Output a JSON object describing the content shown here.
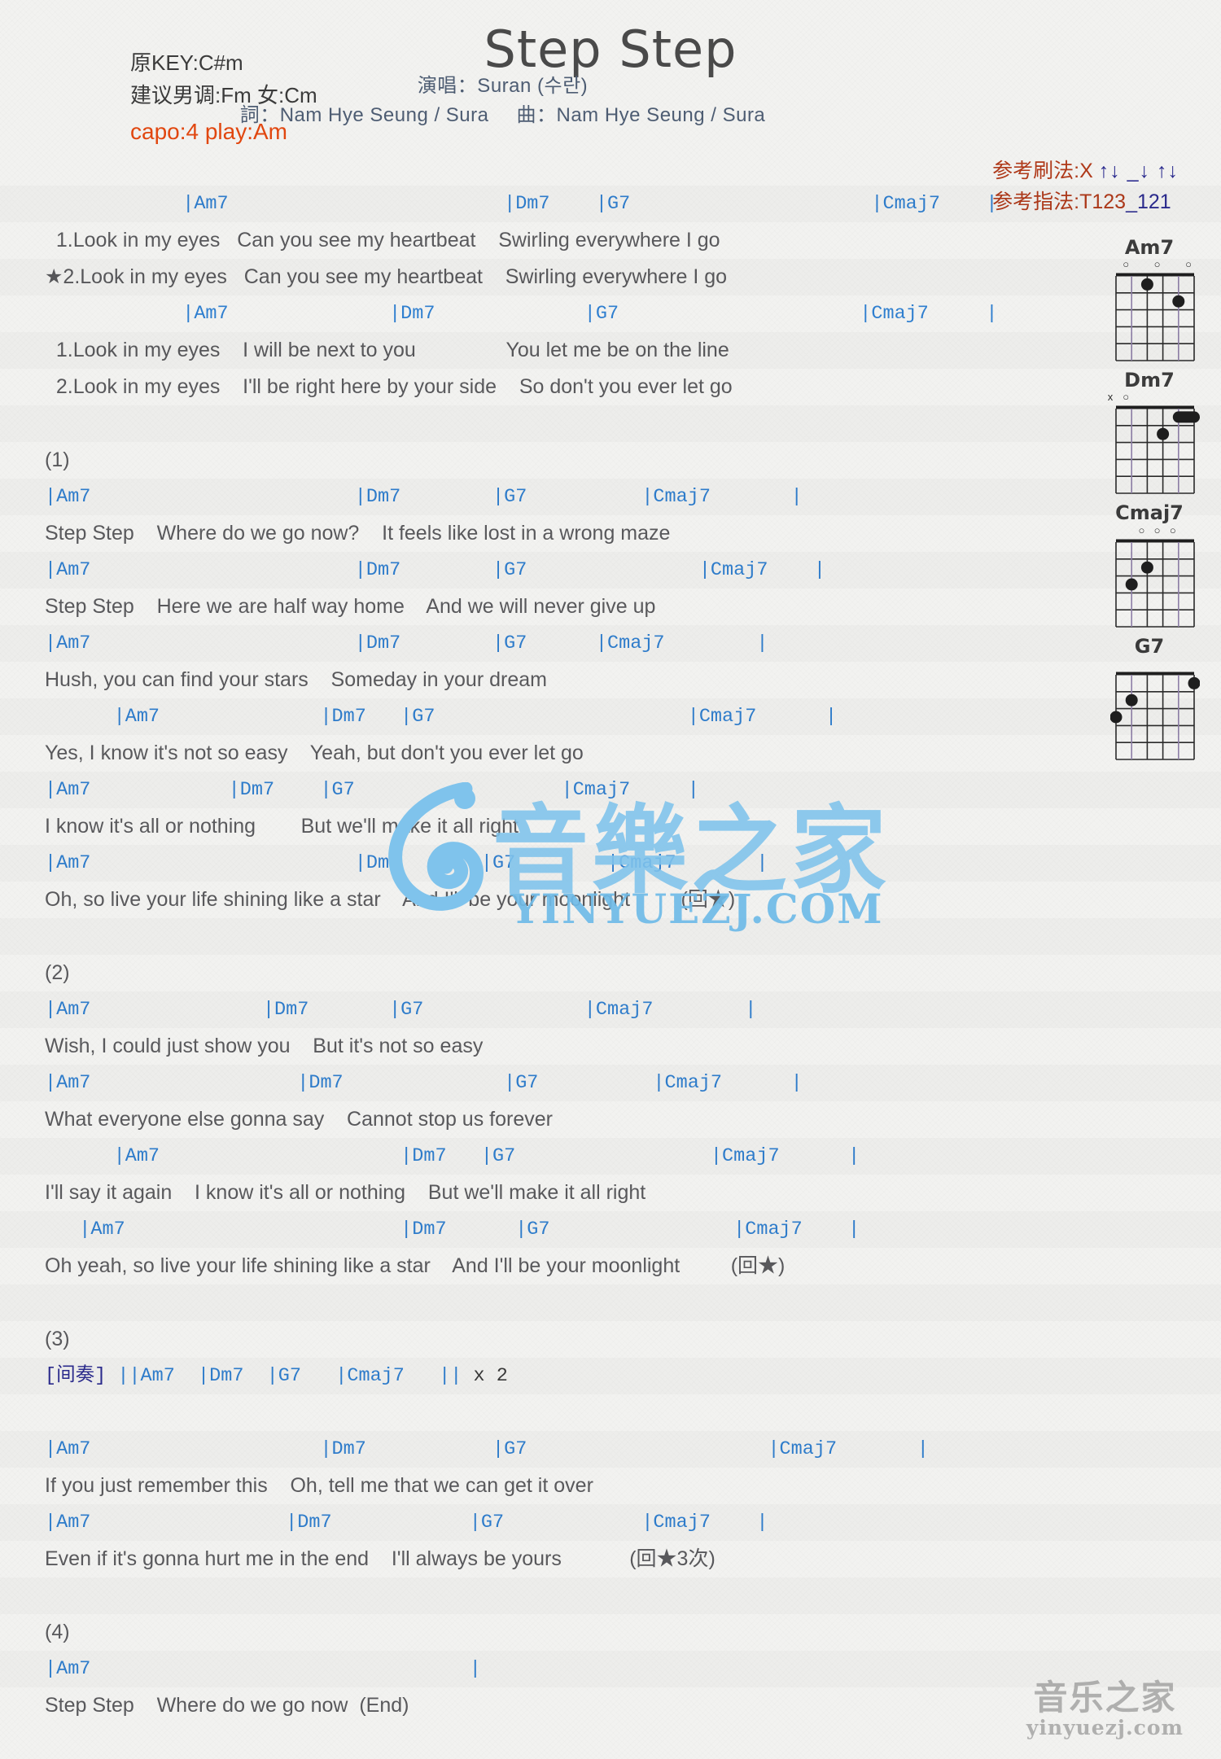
{
  "header": {
    "title": "Step Step",
    "key_original": "原KEY:C#m",
    "key_suggest": "建议男调:Fm 女:Cm",
    "capo": "capo:4 play:Am",
    "singer": "演唱：Suran (수란)",
    "lyricist": "詞：Nam Hye Seung / Sura",
    "composer": "曲：Nam Hye Seung / Sura",
    "strum_label": "参考刷法:X",
    "strum_pattern": "↑↓ _↓ ↑↓",
    "fingerstyle_label": "参考指法:",
    "fingerstyle_pattern_a": "T123",
    "fingerstyle_pattern_b": "_121"
  },
  "chord_diagrams": [
    {
      "name": "Am7",
      "top_markers": [
        {
          "sym": "o",
          "string": 1
        },
        {
          "sym": "o",
          "string": 3
        },
        {
          "sym": "o",
          "string": 5
        }
      ],
      "dots": [
        {
          "string": 2,
          "fret": 1
        },
        {
          "string": 4,
          "fret": 2
        }
      ]
    },
    {
      "name": "Dm7",
      "top_markers": [
        {
          "sym": "x",
          "string": 0
        },
        {
          "sym": "o",
          "string": 1
        }
      ],
      "dots": [
        {
          "string": 3,
          "fret": 2
        }
      ],
      "barre": {
        "fret": 1,
        "from": 4,
        "to": 5
      }
    },
    {
      "name": "Cmaj7",
      "top_markers": [
        {
          "sym": "o",
          "string": 2
        },
        {
          "sym": "o",
          "string": 3
        },
        {
          "sym": "o",
          "string": 4
        }
      ],
      "dots": [
        {
          "string": 2,
          "fret": 2
        },
        {
          "string": 1,
          "fret": 3
        }
      ]
    },
    {
      "name": "G7",
      "top_markers": [],
      "dots": [
        {
          "string": 5,
          "fret": 1
        },
        {
          "string": 1,
          "fret": 2
        },
        {
          "string": 0,
          "fret": 3
        }
      ]
    }
  ],
  "sheet": [
    {
      "type": "chord",
      "text": "            |Am7                        |Dm7    |G7                     |Cmaj7    |"
    },
    {
      "type": "lyric",
      "text": "  1.Look in my eyes   Can you see my heartbeat    Swirling everywhere I go"
    },
    {
      "type": "lyric",
      "text": "★2.Look in my eyes   Can you see my heartbeat    Swirling everywhere I go"
    },
    {
      "type": "chord",
      "text": "            |Am7              |Dm7             |G7                     |Cmaj7     |"
    },
    {
      "type": "lyric",
      "text": "  1.Look in my eyes    I will be next to you                You let me be on the line"
    },
    {
      "type": "lyric",
      "text": "  2.Look in my eyes    I'll be right here by your side    So don't you ever let go"
    },
    {
      "type": "spacer"
    },
    {
      "type": "label",
      "text": "(1)"
    },
    {
      "type": "chord",
      "text": "|Am7                       |Dm7        |G7          |Cmaj7       |"
    },
    {
      "type": "lyric",
      "text": "Step Step    Where do we go now?    It feels like lost in a wrong maze"
    },
    {
      "type": "chord",
      "text": "|Am7                       |Dm7        |G7               |Cmaj7    |"
    },
    {
      "type": "lyric",
      "text": "Step Step    Here we are half way home    And we will never give up"
    },
    {
      "type": "chord",
      "text": "|Am7                       |Dm7        |G7      |Cmaj7        |"
    },
    {
      "type": "lyric",
      "text": "Hush, you can find your stars    Someday in your dream"
    },
    {
      "type": "chord",
      "text": "      |Am7              |Dm7   |G7                      |Cmaj7      |"
    },
    {
      "type": "lyric",
      "text": "Yes, I know it's not so easy    Yeah, but don't you ever let go"
    },
    {
      "type": "chord",
      "text": "|Am7            |Dm7    |G7                  |Cmaj7     |"
    },
    {
      "type": "lyric",
      "text": "I know it's all or nothing        But we'll make it all right"
    },
    {
      "type": "chord",
      "text": "|Am7                       |Dm7       |G7        |Cmaj7       |"
    },
    {
      "type": "lyric",
      "text": "Oh, so live your life shining like a star    And I'll be your moonlight         (回★)"
    },
    {
      "type": "spacer"
    },
    {
      "type": "label",
      "text": "(2)"
    },
    {
      "type": "chord",
      "text": "|Am7               |Dm7       |G7              |Cmaj7        |"
    },
    {
      "type": "lyric",
      "text": "Wish, I could just show you    But it's not so easy"
    },
    {
      "type": "chord",
      "text": "|Am7                  |Dm7              |G7          |Cmaj7      |"
    },
    {
      "type": "lyric",
      "text": "What everyone else gonna say    Cannot stop us forever"
    },
    {
      "type": "chord",
      "text": "      |Am7                     |Dm7   |G7                 |Cmaj7      |"
    },
    {
      "type": "lyric",
      "text": "I'll say it again    I know it's all or nothing    But we'll make it all right"
    },
    {
      "type": "chord",
      "text": "   |Am7                        |Dm7      |G7                |Cmaj7    |"
    },
    {
      "type": "lyric",
      "text": "Oh yeah, so live your life shining like a star    And I'll be your moonlight         (回★)"
    },
    {
      "type": "spacer"
    },
    {
      "type": "label",
      "text": "(3)"
    },
    {
      "type": "interlude",
      "tag": "[间奏]",
      "chords": " ||Am7  |Dm7  |G7   |Cmaj7   ||",
      "times": " x 2"
    },
    {
      "type": "spacer"
    },
    {
      "type": "chord",
      "text": "|Am7                    |Dm7           |G7                     |Cmaj7       |"
    },
    {
      "type": "lyric",
      "text": "If you just remember this    Oh, tell me that we can get it over"
    },
    {
      "type": "chord",
      "text": "|Am7                 |Dm7            |G7            |Cmaj7    |"
    },
    {
      "type": "lyric",
      "text": "Even if it's gonna hurt me in the end    I'll always be yours            (回★3次)"
    },
    {
      "type": "spacer"
    },
    {
      "type": "label",
      "text": "(4)"
    },
    {
      "type": "chord",
      "text": "|Am7                                 |"
    },
    {
      "type": "lyric",
      "text": "Step Step    Where do we go now  (End)"
    }
  ],
  "watermark": {
    "main_cn": "音樂之家",
    "main_url": "YINYUEZJ.COM",
    "bottom_cn": "音乐之家",
    "bottom_url": "yinyuezj.com"
  },
  "colors": {
    "chord": "#2f7fd0",
    "lyric": "#59595c",
    "capo": "#e2470f",
    "credits": "#4e5d73",
    "watermark": "#7fc3ec"
  }
}
